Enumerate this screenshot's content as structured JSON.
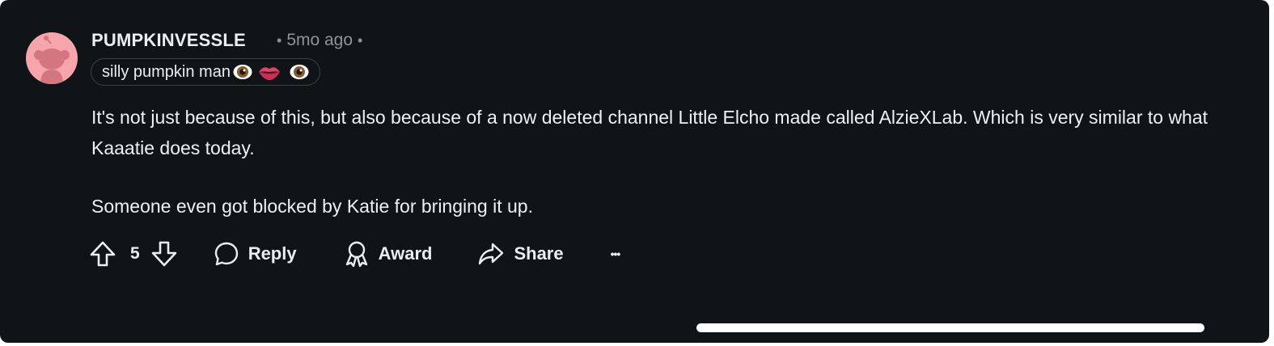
{
  "comment": {
    "author": "PUMPKINVESSLE",
    "age": "5mo ago",
    "flair_text": "silly pumpkin man",
    "flair_emojis": [
      "eye-emoji",
      "lips-emoji",
      "eye-emoji"
    ],
    "body": [
      "It's not just because of this, but also because of a now deleted channel Little Elcho made called AlzieXLab. Which is very similar to what Kaaatie does today.",
      "Someone even got blocked by Katie for bringing it up."
    ]
  },
  "actions": {
    "vote_count": "5",
    "reply_label": "Reply",
    "award_label": "Award",
    "share_label": "Share",
    "more_label": "•••"
  },
  "colors": {
    "background": "#111416",
    "text": "#eef1f3",
    "meta": "#8b9598",
    "avatar_bg": "#f7a5ad"
  }
}
